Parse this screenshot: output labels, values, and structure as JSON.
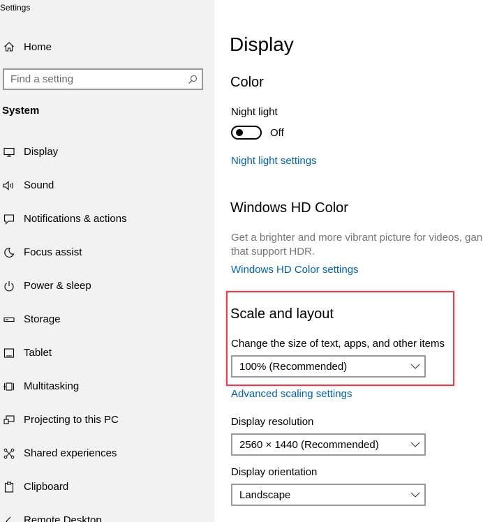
{
  "window": {
    "title": "Settings"
  },
  "sidebar": {
    "home_label": "Home",
    "search_placeholder": "Find a setting",
    "section_heading": "System",
    "items": [
      {
        "label": "Display",
        "icon": "monitor-icon"
      },
      {
        "label": "Sound",
        "icon": "speaker-icon"
      },
      {
        "label": "Notifications & actions",
        "icon": "message-icon"
      },
      {
        "label": "Focus assist",
        "icon": "moon-icon"
      },
      {
        "label": "Power & sleep",
        "icon": "power-icon"
      },
      {
        "label": "Storage",
        "icon": "storage-icon"
      },
      {
        "label": "Tablet",
        "icon": "tablet-icon"
      },
      {
        "label": "Multitasking",
        "icon": "multitasking-icon"
      },
      {
        "label": "Projecting to this PC",
        "icon": "projecting-icon"
      },
      {
        "label": "Shared experiences",
        "icon": "shared-icon"
      },
      {
        "label": "Clipboard",
        "icon": "clipboard-icon"
      },
      {
        "label": "Remote Desktop",
        "icon": "remote-icon"
      }
    ]
  },
  "main": {
    "page_title": "Display",
    "color": {
      "heading": "Color",
      "night_light_label": "Night light",
      "night_light_state": "Off",
      "night_light_on": false,
      "night_light_settings_link": "Night light settings"
    },
    "hd_color": {
      "heading": "Windows HD Color",
      "description_line1": "Get a brighter and more vibrant picture for videos, gan",
      "description_line2": "that support HDR.",
      "settings_link": "Windows HD Color settings"
    },
    "scale_layout": {
      "heading": "Scale and layout",
      "scale_label": "Change the size of text, apps, and other items",
      "scale_value": "100% (Recommended)",
      "advanced_link": "Advanced scaling settings",
      "resolution_label": "Display resolution",
      "resolution_value": "2560 × 1440 (Recommended)",
      "orientation_label": "Display orientation",
      "orientation_value": "Landscape"
    }
  },
  "colors": {
    "sidebar_bg": "#f2f2f2",
    "link": "#0063b1",
    "highlight": "#e04150"
  }
}
